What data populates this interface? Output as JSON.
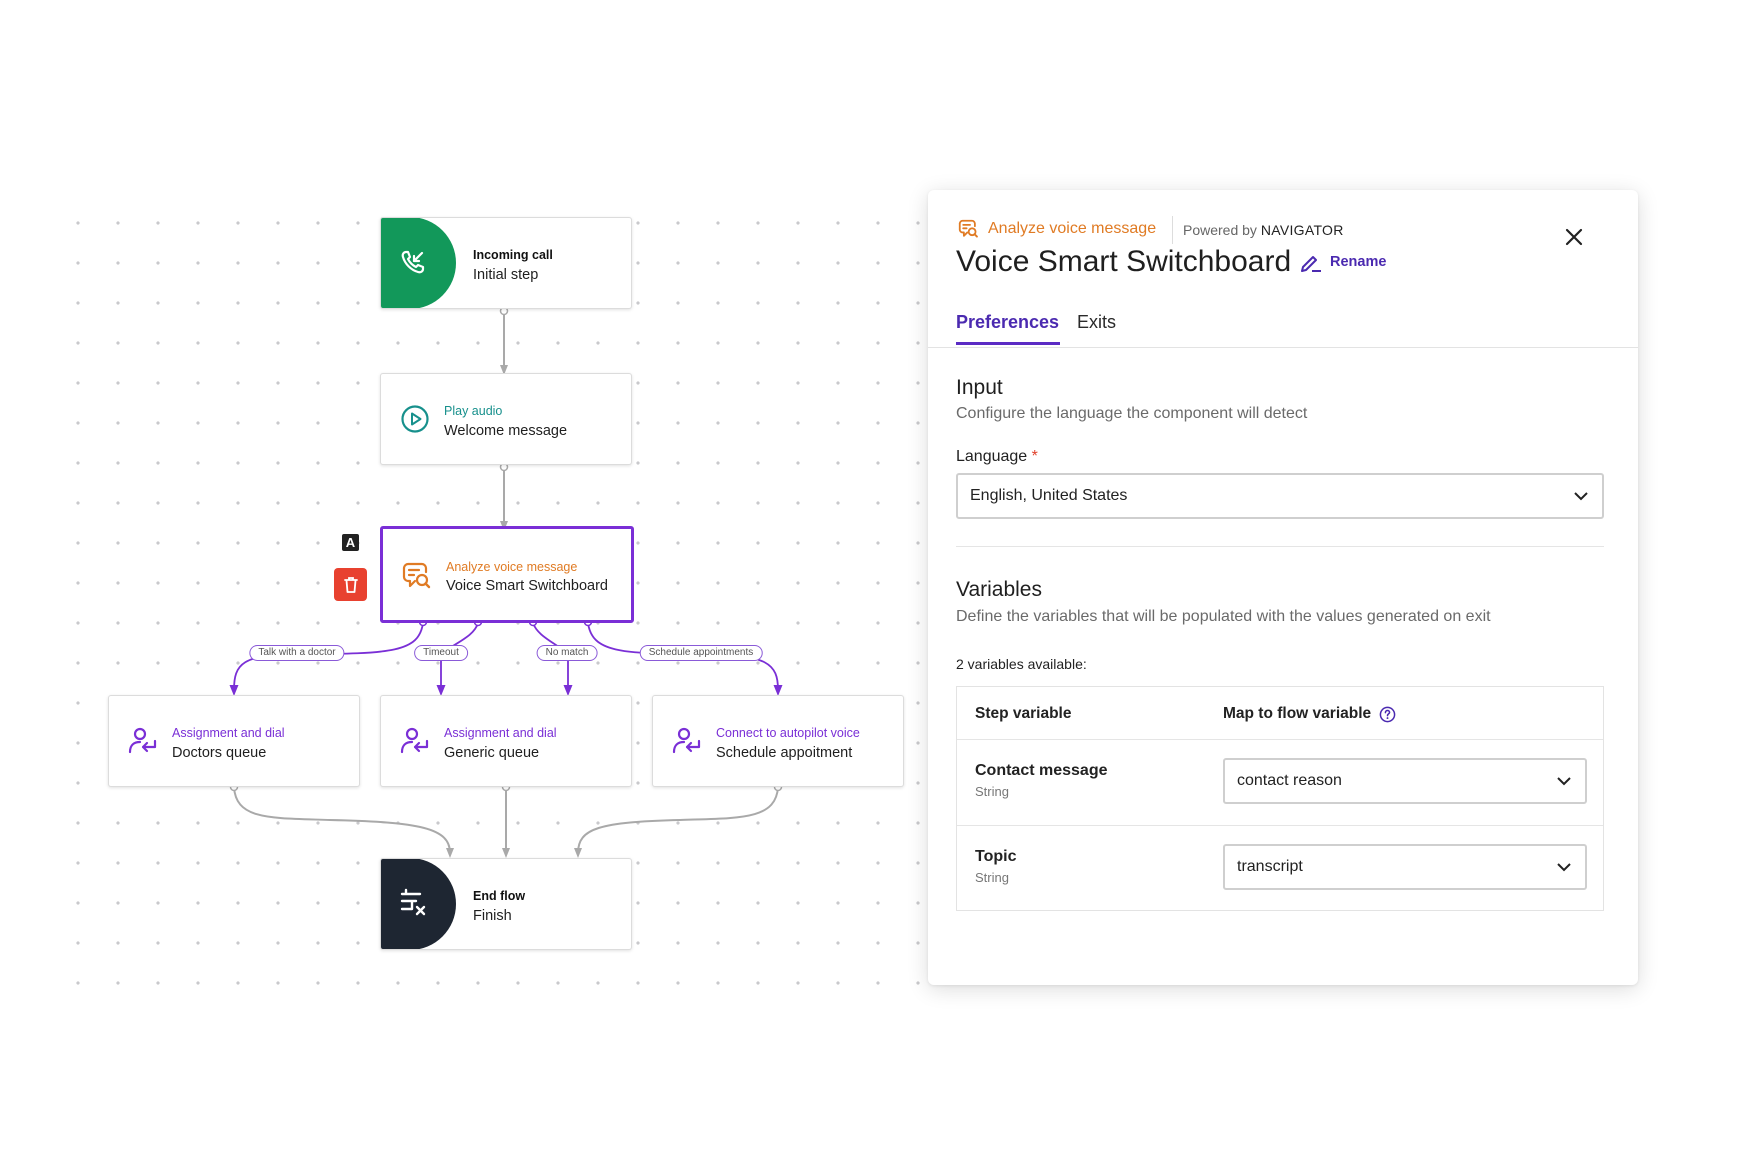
{
  "flow": {
    "nodes": [
      {
        "id": "incoming",
        "type": "Incoming call",
        "label": "Initial step",
        "icon": "phone-incoming-icon",
        "color": "#12985a"
      },
      {
        "id": "play",
        "type": "Play audio",
        "label": "Welcome message",
        "icon": "play-circle-icon",
        "color": "#17908c"
      },
      {
        "id": "analyze",
        "type": "Analyze voice message",
        "label": "Voice Smart Switchboard",
        "icon": "voice-analyze-icon",
        "color": "#e07b24",
        "selected": true
      },
      {
        "id": "doctors",
        "type": "Assignment and dial",
        "label": "Doctors queue",
        "icon": "agent-assign-icon",
        "color": "#7a2fd6"
      },
      {
        "id": "generic",
        "type": "Assignment and dial",
        "label": "Generic queue",
        "icon": "agent-assign-icon",
        "color": "#7a2fd6"
      },
      {
        "id": "schedule",
        "type": "Connect to autopilot voice",
        "label": "Schedule appoitment",
        "icon": "agent-assign-icon",
        "color": "#7a2fd6"
      },
      {
        "id": "end",
        "type": "End flow",
        "label": "Finish",
        "icon": "end-flow-icon",
        "color": "#1e2632"
      }
    ],
    "exits": [
      "Talk with a doctor",
      "Timeout",
      "No match",
      "Schedule appointments"
    ],
    "selected_badge": "A",
    "wire_color": "#a9a9a9",
    "exit_color": "#7a2fd6"
  },
  "panel": {
    "component_type": "Analyze voice message",
    "powered_by_prefix": "Powered by",
    "powered_by_name": "NAVIGATOR",
    "title": "Voice Smart Switchboard",
    "rename_label": "Rename",
    "tabs": [
      {
        "label": "Preferences",
        "active": true
      },
      {
        "label": "Exits",
        "active": false
      }
    ],
    "input": {
      "title": "Input",
      "description": "Configure the language the component will detect",
      "language_label": "Language",
      "required_mark": "*",
      "language_value": "English, United States"
    },
    "variables": {
      "title": "Variables",
      "description": "Define the variables that will be populated with the values generated on exit",
      "count_text": "2 variables available:",
      "col_step": "Step variable",
      "col_map": "Map to flow variable",
      "rows": [
        {
          "name": "Contact message",
          "type": "String",
          "mapped": "contact reason"
        },
        {
          "name": "Topic",
          "type": "String",
          "mapped": "transcript"
        }
      ]
    },
    "accent": "#4b2ab0"
  }
}
